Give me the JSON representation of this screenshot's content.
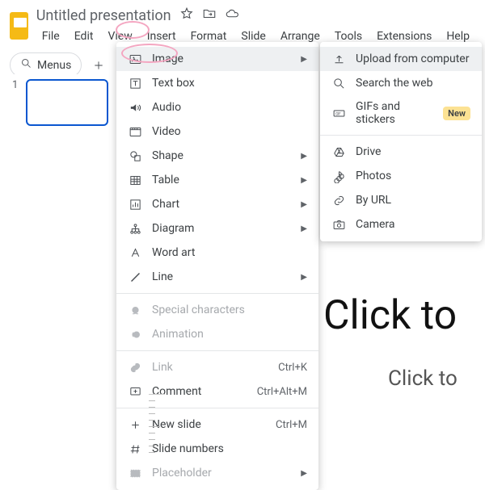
{
  "doc": {
    "title": "Untitled presentation"
  },
  "menubar": {
    "file": "File",
    "edit": "Edit",
    "view": "View",
    "insert": "Insert",
    "format": "Format",
    "slide": "Slide",
    "arrange": "Arrange",
    "tools": "Tools",
    "extensions": "Extensions",
    "help": "Help"
  },
  "toolbar": {
    "menus": "Menus"
  },
  "outline": {
    "slide_number": "1"
  },
  "slide": {
    "title": "Click to",
    "subtitle": "Click to"
  },
  "insert_menu": {
    "image": "Image",
    "text_box": "Text box",
    "audio": "Audio",
    "video": "Video",
    "shape": "Shape",
    "table": "Table",
    "chart": "Chart",
    "diagram": "Diagram",
    "word_art": "Word art",
    "line": "Line",
    "special_chars": "Special characters",
    "animation": "Animation",
    "link": "Link",
    "link_short": "Ctrl+K",
    "comment": "Comment",
    "comment_short": "Ctrl+Alt+M",
    "new_slide": "New slide",
    "new_slide_short": "Ctrl+M",
    "slide_numbers": "Slide numbers",
    "placeholder": "Placeholder"
  },
  "image_submenu": {
    "upload": "Upload from computer",
    "search": "Search the web",
    "gifs": "GIFs and stickers",
    "gifs_badge": "New",
    "drive": "Drive",
    "photos": "Photos",
    "by_url": "By URL",
    "camera": "Camera"
  }
}
